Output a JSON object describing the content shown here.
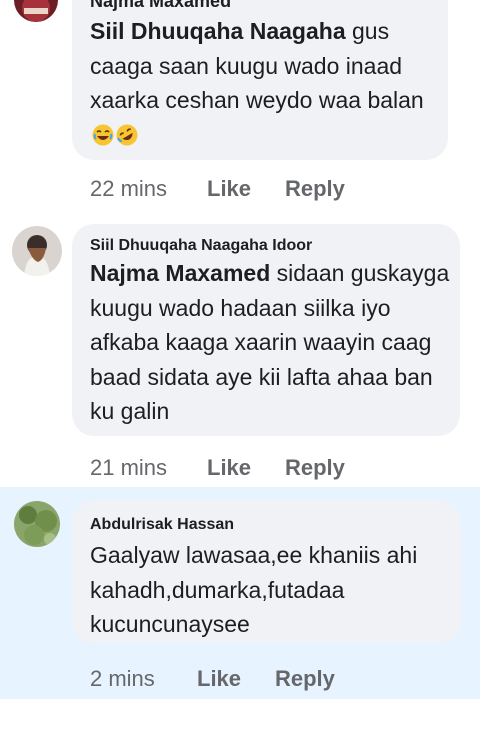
{
  "comments": [
    {
      "author": "Najma Maxamed",
      "mention": "Siil Dhuuqaha Naagaha",
      "text": " gus caaga saan kuugu wado inaad xaarka ceshan weydo waa balan",
      "time": "22 mins",
      "like": "Like",
      "reply": "Reply"
    },
    {
      "author": "Siil Dhuuqaha Naagaha Idoor",
      "mention": "Najma Maxamed",
      "text": " sidaan guskayga kuugu wado hadaan siilka iyo afkaba kaaga xaarin waayin caag baad sidata aye kii lafta ahaa ban ku galin",
      "time": "21 mins",
      "like": "Like",
      "reply": "Reply"
    },
    {
      "author": "Abdulrisak Hassan",
      "text": "Gaalyaw lawasaa,ee khaniis ahi kahadh,dumarka,futadaa kucuncunaysee",
      "time": "2 mins",
      "like": "Like",
      "reply": "Reply"
    }
  ],
  "icons": {
    "emoji_1": "laughing-face-icon",
    "emoji_2": "rofl-face-icon"
  },
  "colors": {
    "bubble": "#f0f2f5",
    "highlight": "#e7f3ff",
    "meta_text": "#65676b"
  }
}
